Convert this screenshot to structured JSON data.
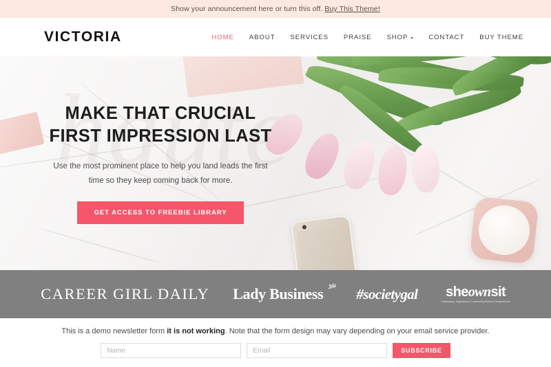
{
  "announcement": {
    "text": "Show your announcement here or turn this off.",
    "link_label": "Buy This Theme!"
  },
  "header": {
    "logo": "VICTORIA",
    "nav": [
      {
        "label": "HOME",
        "active": true,
        "dropdown": false
      },
      {
        "label": "ABOUT",
        "active": false,
        "dropdown": false
      },
      {
        "label": "SERVICES",
        "active": false,
        "dropdown": false
      },
      {
        "label": "PRAISE",
        "active": false,
        "dropdown": false
      },
      {
        "label": "SHOP",
        "active": false,
        "dropdown": true
      },
      {
        "label": "CONTACT",
        "active": false,
        "dropdown": false
      },
      {
        "label": "BUY THEME",
        "active": false,
        "dropdown": false
      }
    ]
  },
  "hero": {
    "title": "MAKE THAT CRUCIAL FIRST IMPRESSION LAST",
    "subtitle": "Use the most prominent place to help you land leads the first time so they keep coming back for more.",
    "cta_label": "GET ACCESS TO FREEBIE LIBRARY",
    "watermark": "haute",
    "image_description": "Flatlay of pink tulips, gold smartphone, pink candle and gold earbuds on white marble"
  },
  "logo_band": {
    "brands": [
      {
        "name": "CAREER GIRL DAILY",
        "style": "serif"
      },
      {
        "name": "Lady Business",
        "suffix": ".biz",
        "style": "slab"
      },
      {
        "name": "#societygal",
        "style": "script"
      },
      {
        "name": "sheownsit",
        "name_part1": "she",
        "name_part2": "own",
        "name_part3": "sit",
        "tagline": "Celebrating, Supporting & Connecting Women Entrepreneurs",
        "style": "mixed"
      }
    ]
  },
  "newsletter": {
    "note_before": "This is a demo newsletter form ",
    "note_bold": "it is not working",
    "note_after": ". Note that the form design may vary depending on your email service provider.",
    "name_placeholder": "Name",
    "name_value": "",
    "email_placeholder": "Email",
    "email_value": "",
    "subscribe_label": "SUBSCRIBE"
  },
  "colors": {
    "accent": "#f5566a",
    "announce_bg": "#fce9e1",
    "band_bg": "#808080"
  }
}
